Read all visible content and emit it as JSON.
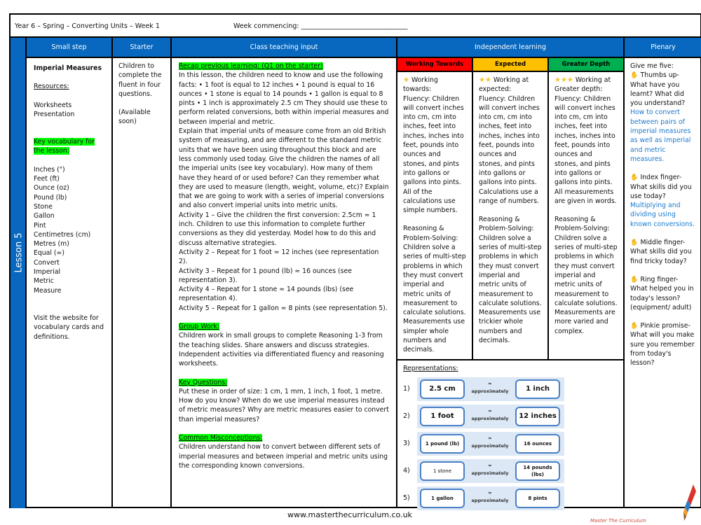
{
  "header": {
    "title": "Year 6 – Spring – Converting Units – Week 1",
    "week_commencing": "Week commencing: ________________________________"
  },
  "lesson_label": "Lesson 5",
  "columns": {
    "small_step": "Small step",
    "starter": "Starter",
    "class_teaching": "Class teaching input",
    "independent": "Independent learning",
    "plenary": "Plenary"
  },
  "small_step": {
    "title": "Imperial Measures",
    "resources_label": "Resources:",
    "resources": [
      "Worksheets",
      "Presentation"
    ],
    "vocab_label": "Key vocabulary for the lesson:",
    "vocab": [
      "Inches (\")",
      "Feet (ft)",
      "Ounce (oz)",
      "Pound (lb)",
      "Stone",
      "Gallon",
      "Pint",
      "Centimetres (cm)",
      "Metres (m)",
      "Equal (=)",
      "Convert",
      "Imperial",
      "Metric",
      "Measure"
    ],
    "visit_note": "Visit the website for vocabulary cards and definitions."
  },
  "starter": {
    "text": "Children to complete the fluent in four questions.",
    "note": "(Available soon)"
  },
  "teaching": {
    "recap_label": "Recap previous learning: (Q1 on the starter)",
    "recap_text": "In this lesson, the children need to know and use the following facts: • 1 foot is equal to 12 inches • 1 pound is equal to 16 ounces • 1 stone is equal to 14 pounds • 1 gallon is equal to 8 pints • 1 inch is approximately 2.5 cm They should use these to perform related conversions, both within imperial measures and between imperial and metric.",
    "explain_text": "Explain that imperial units of measure come from an old British system of measuring, and are different to the standard metric units that we have been using throughout this block and are less commonly used today. Give the children the names of all the imperial units (see key vocabulary). How many of them have they heard of or used before? Can they remember what they are used to measure (length, weight, volume, etc)? Explain that we are going to work with a series of imperial conversions and also convert imperial units into metric units.",
    "activities": [
      "Activity 1 – Give the children the first conversion: 2.5cm ≈ 1 inch. Children to use this information to complete further conversions as they did yesterday. Model how to do this and discuss alternative strategies.",
      "Activity  2 –  Repeat for 1 foot ≈ 12 inches (see representation 2).",
      "Activity 3 – Repeat for 1 pound (lb)  ≈ 16 ounces (see representation 3).",
      "Activity 4 – Repeat for 1 stone ≈ 14 pounds (lbs) (see representation 4).",
      "Activity 5 – Repeat for 1 gallon ≈ 8 pints (see representation 5)."
    ],
    "group_label": "Group Work:",
    "group_text": "Children work in small groups to complete Reasoning 1-3 from the teaching slides. Share answers and discuss strategies. Independent activities via differentiated fluency and reasoning worksheets.",
    "questions_label": "Key Questions:",
    "questions_text": "Put these in order of size: 1 cm, 1 mm, 1 inch, 1 foot, 1 metre. How do you know? When do we use imperial measures instead of metric measures? Why are metric measures easier to convert than imperial measures?",
    "misconceptions_label": "Common Misconceptions:",
    "misconceptions_text": "Children understand how to convert between different sets of imperial measures and between imperial and metric units using the corresponding known conversions."
  },
  "independent": {
    "levels": [
      {
        "band": "Working Towards",
        "color": "#ff0000",
        "stars": "★",
        "heading": "Working towards:",
        "fluency": "Fluency:  Children will convert inches into cm, cm into inches, feet into inches, inches into feet, pounds into ounces and stones, and pints into gallons or gallons into pints. All of the calculations use simple numbers.",
        "reasoning": "Reasoning & Problem-Solving: Children solve a series of multi-step problems in which they must convert imperial and metric units of measurement to calculate solutions. Measurements use simpler whole numbers and decimals."
      },
      {
        "band": "Expected",
        "color": "#ffc000",
        "stars": "★★",
        "heading": "Working at expected:",
        "fluency": "Fluency: Children will convert inches into cm, cm into inches, feet into inches, inches into feet, pounds into ounces and stones, and pints into gallons or gallons into pints. Calculations use a range of numbers.",
        "reasoning": "Reasoning & Problem-Solving: Children solve a series of multi-step problems in which they must convert imperial and metric units of measurement to calculate solutions. Measurements use trickier whole numbers and decimals."
      },
      {
        "band": "Greater Depth",
        "color": "#00b050",
        "stars": "★★★",
        "heading": "Working at Greater depth:",
        "fluency": "Fluency: Children will convert inches into cm, cm into inches, feet into inches, inches into feet, pounds into ounces and stones, and pints into gallons or gallons into pints. All measurements are given in words.",
        "reasoning": "Reasoning & Problem-Solving: Children solve a series of multi-step problems in which they must convert imperial and metric units of measurement to calculate solutions. Measurements are more varied and complex."
      }
    ],
    "representations_label": "Representations:",
    "representations": [
      {
        "num": "1)",
        "left": "2.5 cm",
        "symbol": "≈",
        "word": "approximately",
        "right": "1 inch"
      },
      {
        "num": "2)",
        "left": "1 foot",
        "symbol": "≈",
        "word": "approximately",
        "right": "12 inches"
      },
      {
        "num": "3)",
        "left": "1 pound (lb)",
        "symbol": "≈",
        "word": "approximately",
        "right": "16 ounces"
      },
      {
        "num": "4)",
        "left": "1 stone",
        "symbol": "≈",
        "word": "approximately",
        "right": "14 pounds (lbs)"
      },
      {
        "num": "5)",
        "left": "1 gallon",
        "symbol": "≈",
        "word": "approximately",
        "right": "8 pints"
      }
    ]
  },
  "plenary": {
    "intro": "Give me five:",
    "items": [
      {
        "icon": "hand-icon",
        "prompt": "Thumbs up- What have you learnt? What did you understand?",
        "answer": "How to convert between pairs of imperial measures as well as imperial and metric measures."
      },
      {
        "icon": "hand-icon",
        "prompt": "Index finger- What skills did you use today?",
        "answer": "Multiplying and dividing using known conversions."
      },
      {
        "icon": "hand-icon",
        "prompt": "Middle finger- What skills did you find tricky today?",
        "answer": ""
      },
      {
        "icon": "hand-icon",
        "prompt": "Ring finger- What helped you in today's lesson? (equipment/ adult)",
        "answer": ""
      },
      {
        "icon": "hand-icon",
        "prompt": "Pinkie promise- What will you make sure you remember from today's lesson?",
        "answer": ""
      }
    ]
  },
  "footer": {
    "url": "www.masterthecurriculum.co.uk",
    "brand": "Master The Curriculum"
  }
}
